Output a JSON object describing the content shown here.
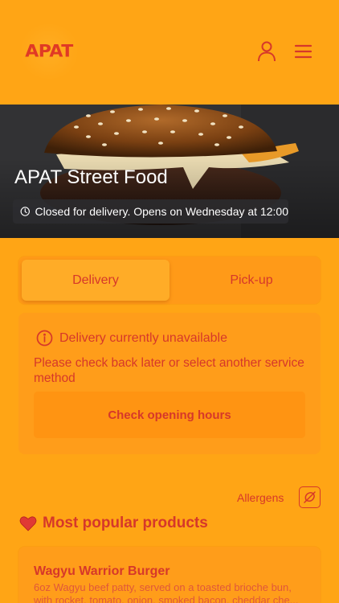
{
  "header": {
    "logo_text": "APAT",
    "icons": [
      "user-icon",
      "menu-icon"
    ]
  },
  "hero": {
    "restaurant_name": "APAT Street Food",
    "status_text": "Closed for delivery. Opens on Wednesday at 12:00"
  },
  "tabs": [
    {
      "label": "Delivery",
      "active": true
    },
    {
      "label": "Pick-up",
      "active": false
    }
  ],
  "notice": {
    "title": "Delivery currently unavailable",
    "message": "Please check back later or select another service method",
    "button_label": "Check opening hours"
  },
  "allergens": {
    "label": "Allergens"
  },
  "section": {
    "title": "Most popular products"
  },
  "products": [
    {
      "name": "Wagyu Warrior Burger",
      "description": "6oz Wagyu beef patty, served on a toasted brioche bun, with rocket, tomato, onion, smoked bacon, cheddar che..."
    }
  ],
  "colors": {
    "background": "#ffa515",
    "accent": "#d6382a"
  }
}
